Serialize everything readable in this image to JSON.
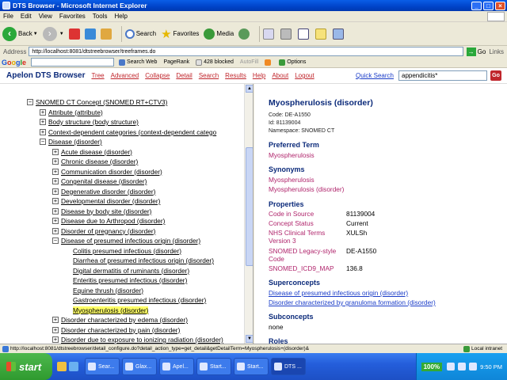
{
  "window": {
    "title": "DTS Browser - Microsoft Internet Explorer"
  },
  "menu": [
    "File",
    "Edit",
    "View",
    "Favorites",
    "Tools",
    "Help"
  ],
  "toolbar": {
    "back": "Back",
    "search": "Search",
    "favorites": "Favorites",
    "media": "Media"
  },
  "address": {
    "label": "Address",
    "url": "http://localhost:8081/dtstreebrowser/treeframes.do",
    "go": "Go",
    "links": "Links"
  },
  "google": {
    "logo": "Google",
    "search_web": "Search Web",
    "pagerank": "PageRank",
    "blocked": "428 blocked",
    "autofill": "AutoFill",
    "options": "Options"
  },
  "app": {
    "brand": "Apelon DTS Browser",
    "nav": [
      "Tree",
      "Advanced",
      "Collapse",
      "Detail",
      "Search",
      "Results",
      "Help",
      "About",
      "Logout"
    ],
    "quick_search_label": "Quick Search",
    "quick_search_value": "appendicitis*",
    "go": "Go"
  },
  "tree": [
    {
      "level": 0,
      "box": "−",
      "label": "SNOMED CT Concept (SNOMED RT+CTV3)"
    },
    {
      "level": 1,
      "box": "+",
      "label": "Attribute (attribute)"
    },
    {
      "level": 1,
      "box": "+",
      "label": "Body structure (body structure)"
    },
    {
      "level": 1,
      "box": "+",
      "label": "Context-dependent categories (context-dependent catego"
    },
    {
      "level": 1,
      "box": "−",
      "label": "Disease (disorder)"
    },
    {
      "level": 2,
      "box": "+",
      "label": "Acute disease (disorder)"
    },
    {
      "level": 2,
      "box": "+",
      "label": "Chronic disease (disorder)"
    },
    {
      "level": 2,
      "box": "+",
      "label": "Communication disorder (disorder)"
    },
    {
      "level": 2,
      "box": "+",
      "label": "Congenital disease (disorder)"
    },
    {
      "level": 2,
      "box": "+",
      "label": "Degenerative disorder (disorder)"
    },
    {
      "level": 2,
      "box": "+",
      "label": "Developmental disorder (disorder)"
    },
    {
      "level": 2,
      "box": "+",
      "label": "Disease by body site (disorder)"
    },
    {
      "level": 2,
      "box": "+",
      "label": "Disease due to Arthropod (disorder)"
    },
    {
      "level": 2,
      "box": "+",
      "label": "Disorder of pregnancy (disorder)"
    },
    {
      "level": 2,
      "box": "−",
      "label": "Disease of presumed infectious origin (disorder)"
    },
    {
      "level": 3,
      "box": "",
      "label": "Colitis presumed infectious (disorder)"
    },
    {
      "level": 3,
      "box": "",
      "label": "Diarrhea of presumed infectious origin (disorder)"
    },
    {
      "level": 3,
      "box": "",
      "label": "Digital dermatitis of ruminants (disorder)"
    },
    {
      "level": 3,
      "box": "",
      "label": "Enteritis presumed infectious (disorder)"
    },
    {
      "level": 3,
      "box": "",
      "label": "Equine thrush (disorder)"
    },
    {
      "level": 3,
      "box": "",
      "label": "Gastroenteritis presumed infectious (disorder)"
    },
    {
      "level": 3,
      "box": "",
      "label": "Myospherulosis (disorder)",
      "selected": true
    },
    {
      "level": 2,
      "box": "+",
      "label": "Disorder characterized by edema (disorder)"
    },
    {
      "level": 2,
      "box": "+",
      "label": "Disorder characterized by pain (disorder)"
    },
    {
      "level": 2,
      "box": "+",
      "label": "Disorder due to exposure to ionizing radiation (disorder)"
    }
  ],
  "detail": {
    "title": "Myospherulosis (disorder)",
    "code": "Code: DE-A1550",
    "id": "Id: 81139004",
    "namespace": "Namespace: SNOMED CT",
    "preferred_heading": "Preferred Term",
    "preferred": "Myospherulosis",
    "synonyms_heading": "Synonyms",
    "synonyms": [
      "Myospherulosis",
      "Myospherulosis (disorder)"
    ],
    "properties_heading": "Properties",
    "properties": [
      {
        "k": "Code in Source",
        "v": "81139004"
      },
      {
        "k": "Concept Status",
        "v": "Current"
      },
      {
        "k": "NHS Clinical Terms Version 3",
        "v": "XULSh"
      },
      {
        "k": "SNOMED Legacy-style Code",
        "v": "DE-A1550"
      },
      {
        "k": "SNOMED_ICD9_MAP",
        "v": "136.8"
      }
    ],
    "super_heading": "Superconcepts",
    "superconcepts": [
      "Disease of presumed infectious origin (disorder)",
      "Disorder characterized by granuloma formation (disorder)"
    ],
    "sub_heading": "Subconcepts",
    "subconcepts": "none",
    "roles_heading": "Roles"
  },
  "status": {
    "text": "http://localhost:8081/dtstreebrowser/detail_configure.do?detail_action_type=get_detail&getDetailTerm=Myospherulosis+(disorder)&",
    "zone": "Local intranet"
  },
  "taskbar": {
    "start": "start",
    "tasks": [
      "Sear...",
      "Glax...",
      "Apel...",
      "Start...",
      "Start...",
      "DTS ..."
    ],
    "battery": "100%",
    "clock": "9:50 PM"
  },
  "colors": {
    "nav_link": "#c0262c",
    "heading": "#0b2a7a",
    "property_key": "#b0256c",
    "highlight": "#ffff66"
  }
}
